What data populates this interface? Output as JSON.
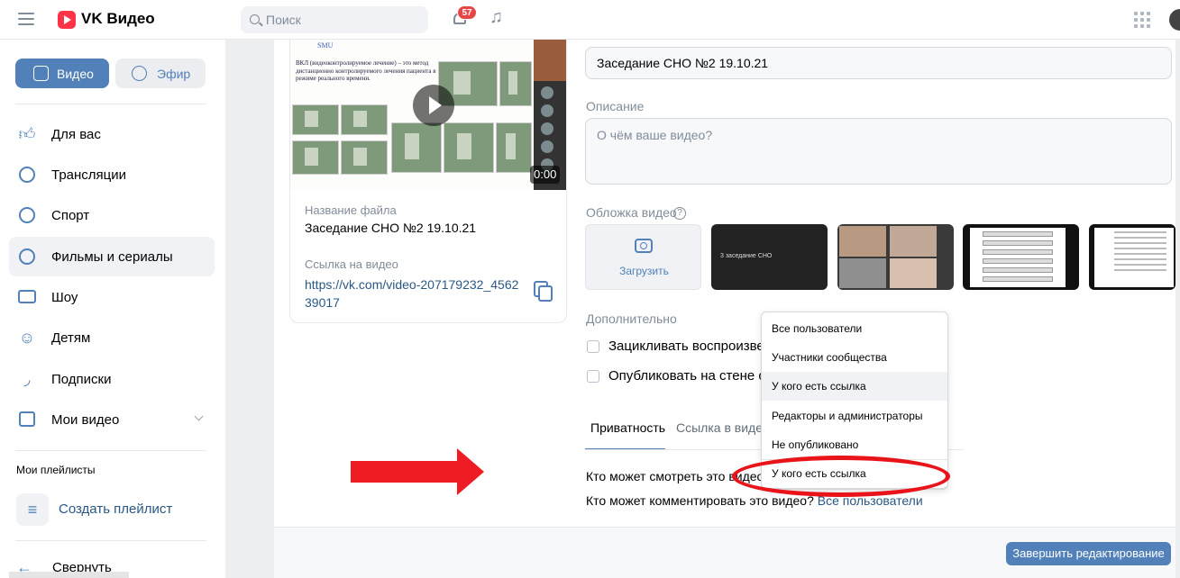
{
  "header": {
    "logo": "VK Видео",
    "search_placeholder": "Поиск",
    "notifications_count": "57"
  },
  "sidebar": {
    "tabs": [
      {
        "label": "Видео",
        "active": true
      },
      {
        "label": "Эфир",
        "active": false
      }
    ],
    "items": [
      {
        "label": "Для вас",
        "icon": "thumb-up-icon"
      },
      {
        "label": "Трансляции",
        "icon": "broadcast-icon"
      },
      {
        "label": "Спорт",
        "icon": "ball-icon"
      },
      {
        "label": "Фильмы и сериалы",
        "icon": "film-reel-icon",
        "active": true
      },
      {
        "label": "Шоу",
        "icon": "tv-icon"
      },
      {
        "label": "Детям",
        "icon": "kids-icon"
      },
      {
        "label": "Подписки",
        "icon": "subscriptions-icon"
      },
      {
        "label": "Мои видео",
        "icon": "my-video-icon"
      }
    ],
    "playlists_heading": "Мои плейлисты",
    "create_playlist": "Создать плейлист",
    "collapse": "Свернуть"
  },
  "file_card": {
    "duration": "0:00",
    "slide_logo": "SMU",
    "slide_text": "ВКЛ (видеоконтролируемое лечение) – это метод дистанционно контролируемого лечения пациента в режиме реального времени.",
    "file_name_label": "Название файла",
    "file_name": "Заседание СНО №2 19.10.21",
    "link_label": "Ссылка на видео",
    "link": "https://vk.com/video-207179232_456239017"
  },
  "form": {
    "title_value": "Заседание СНО №2 19.10.21",
    "description_label": "Описание",
    "description_placeholder": "О чём ваше видео?",
    "cover_label": "Обложка видео",
    "upload_label": "Загрузить",
    "cover1_text": "3 заседание СНО",
    "additional_label": "Дополнительно",
    "checkbox_loop": "Зацикливать воспроизвед",
    "checkbox_publish": "Опубликовать на стене сос",
    "tabs": [
      "Приватность",
      "Ссылка в видео"
    ],
    "privacy_view_label": "Кто может смотреть это видео?",
    "privacy_comment_label": "Кто может комментировать это видео?",
    "privacy_comment_value": "Все пользователи",
    "finish_button": "Завершить редактирование"
  },
  "dropdown": {
    "options": [
      "Все пользователи",
      "Участники сообщества",
      "У кого есть ссылка",
      "Редакторы и администраторы",
      "Не опубликовано"
    ],
    "current": "У кого есть ссылка"
  },
  "colors": {
    "accent": "#5181b8",
    "annotation_red": "#e8141a",
    "badge_red": "#e64646"
  }
}
